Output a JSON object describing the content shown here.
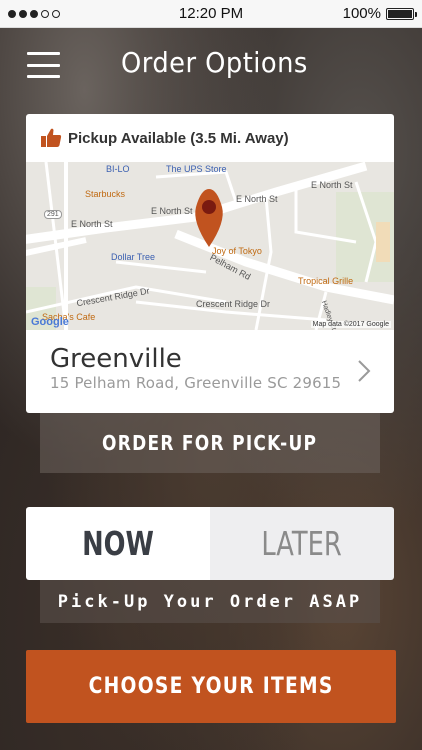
{
  "status_bar": {
    "time": "12:20 PM",
    "battery": "100%",
    "signal_strength": 3,
    "battery_level": 1.0
  },
  "header": {
    "title": "Order Options",
    "menu_icon": "hamburger-menu-icon"
  },
  "location_card": {
    "pickup_text": "Pickup Available (3.5 Mi. Away)",
    "pickup_icon": "thumbs-up-icon",
    "map": {
      "streets": [
        "E North St",
        "E North St",
        "E North St",
        "E North St",
        "Pelham Rd",
        "Crescent Ridge Dr",
        "Crescent Ridge Dr"
      ],
      "pois": [
        "BI-LO",
        "The UPS Store",
        "Starbucks",
        "Dollar Tree",
        "Joy of Tokyo",
        "Tropical Grille",
        "Sacha's Cafe"
      ],
      "route_label": "291",
      "side_street": "Hadley Ct",
      "map_data": "Map data ©2017 Google",
      "google_logo": "Google"
    },
    "name": "Greenville",
    "address": "15 Pelham Road, Greenville SC 29615",
    "chevron_icon": "chevron-right-icon"
  },
  "order_type_button": "ORDER FOR PICK-UP",
  "time_toggle": {
    "now_label": "NOW",
    "later_label": "LATER",
    "selected": "NOW"
  },
  "asap_text": "Pick-Up Your Order ASAP",
  "choose_button": "CHOOSE YOUR ITEMS",
  "colors": {
    "accent": "#c1531f",
    "pin": "#c1531f",
    "map_bg": "#e8e6e1"
  }
}
